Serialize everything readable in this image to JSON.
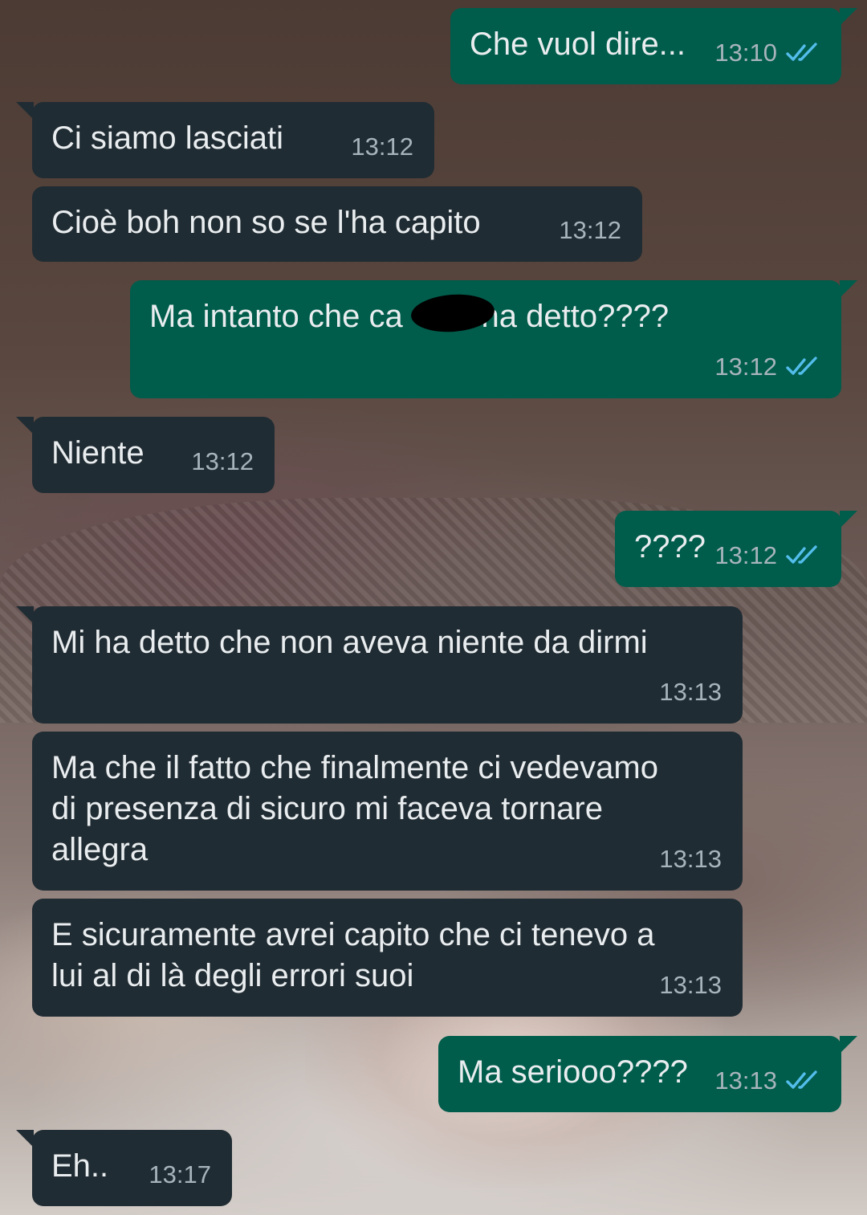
{
  "colors": {
    "incoming_bubble": "#202c33",
    "outgoing_bubble": "#005c4b",
    "text": "#e9edef",
    "timestamp": "#a7b4bb",
    "read_ticks": "#53bdeb"
  },
  "messages": [
    {
      "direction": "outgoing",
      "text": "Che vuol dire...",
      "time": "13:10",
      "status": "read"
    },
    {
      "direction": "incoming",
      "text": "Ci siamo lasciati",
      "time": "13:12"
    },
    {
      "direction": "incoming",
      "text": "Cioè boh non so se l'ha capito",
      "time": "13:12"
    },
    {
      "direction": "outgoing",
      "text": "Ma intanto che ca      ti ha detto????",
      "time": "13:12",
      "status": "read",
      "redacted": true
    },
    {
      "direction": "incoming",
      "text": "Niente",
      "time": "13:12"
    },
    {
      "direction": "outgoing",
      "text": "????",
      "time": "13:12",
      "status": "read"
    },
    {
      "direction": "incoming",
      "text": "Mi ha detto che non aveva niente da dirmi",
      "time": "13:13"
    },
    {
      "direction": "incoming",
      "text": "Ma che il fatto che finalmente ci vedevamo\ndi presenza di sicuro mi faceva tornare\nallegra",
      "time": "13:13"
    },
    {
      "direction": "incoming",
      "text": "E sicuramente avrei capito che ci tenevo a\nlui al di là degli errori suoi",
      "time": "13:13"
    },
    {
      "direction": "outgoing",
      "text": "Ma seriooo????",
      "time": "13:13",
      "status": "read"
    },
    {
      "direction": "incoming",
      "text": "Eh..",
      "time": "13:17"
    }
  ]
}
